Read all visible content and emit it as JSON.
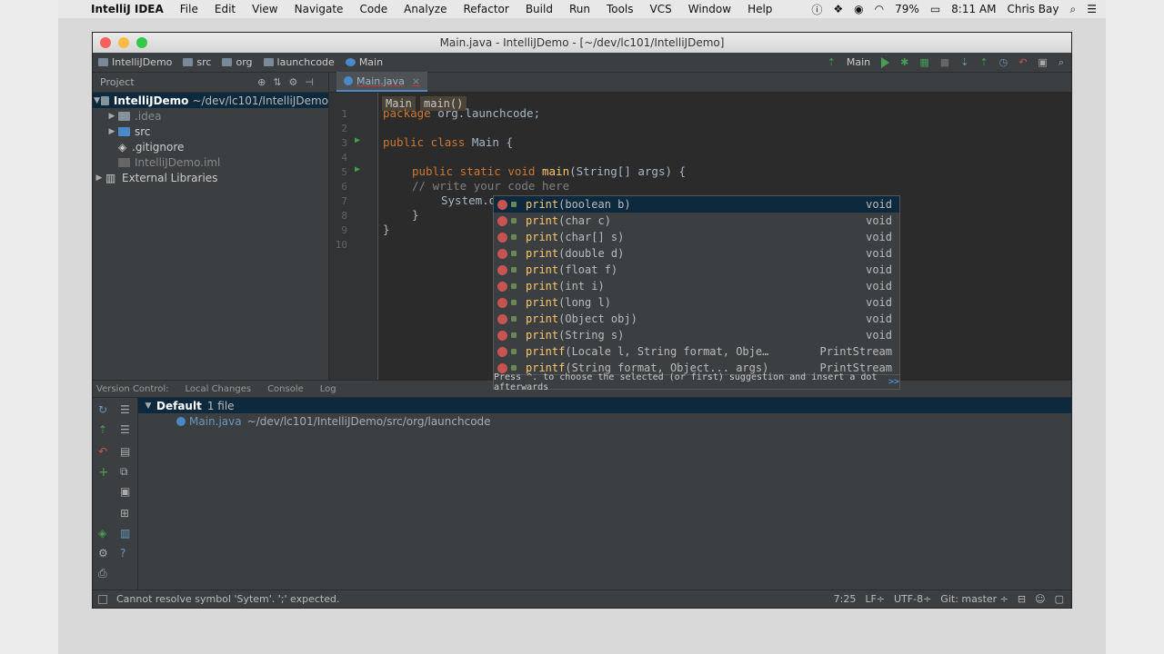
{
  "menubar": {
    "app": "IntelliJ IDEA",
    "items": [
      "File",
      "Edit",
      "View",
      "Navigate",
      "Code",
      "Analyze",
      "Refactor",
      "Build",
      "Run",
      "Tools",
      "VCS",
      "Window",
      "Help"
    ],
    "battery": "79%",
    "time": "8:11 AM",
    "user": "Chris Bay"
  },
  "window": {
    "title": "Main.java - IntelliJDemo - [~/dev/lc101/IntelliJDemo]"
  },
  "navbar": {
    "crumbs": [
      "IntelliJDemo",
      "src",
      "org",
      "launchcode",
      "Main"
    ],
    "run_config": "Main"
  },
  "project": {
    "header": "Project",
    "root": "IntelliJDemo",
    "root_path": "~/dev/lc101/IntelliJDemo",
    "items": [
      ".idea",
      "src",
      ".gitignore",
      "IntelliJDemo.iml"
    ],
    "external": "External Libraries"
  },
  "editor": {
    "tab": "Main.java",
    "breadcrumb": [
      "Main",
      "main()"
    ],
    "lines": [
      "1",
      "2",
      "3",
      "4",
      "5",
      "6",
      "7",
      "8",
      "9",
      "10"
    ],
    "code": {
      "l1_kw": "package",
      "l1_rest": " org.launchcode;",
      "l3_kw": "public class",
      "l3_rest": " Main {",
      "l5_kw": "public static void",
      "l5_fn": "main",
      "l5_rest": "(String[] args) {",
      "l6": "// write your code here",
      "l7": "System.out.print",
      "l8": "}",
      "l9": "}"
    }
  },
  "completion": {
    "items": [
      {
        "name": "print",
        "args": "(boolean b)",
        "type": "void"
      },
      {
        "name": "print",
        "args": "(char c)",
        "type": "void"
      },
      {
        "name": "print",
        "args": "(char[] s)",
        "type": "void"
      },
      {
        "name": "print",
        "args": "(double d)",
        "type": "void"
      },
      {
        "name": "print",
        "args": "(float f)",
        "type": "void"
      },
      {
        "name": "print",
        "args": "(int i)",
        "type": "void"
      },
      {
        "name": "print",
        "args": "(long l)",
        "type": "void"
      },
      {
        "name": "print",
        "args": "(Object obj)",
        "type": "void"
      },
      {
        "name": "print",
        "args": "(String s)",
        "type": "void"
      },
      {
        "name": "printf",
        "args": "(Locale l, String format, Obje…",
        "type": "PrintStream"
      },
      {
        "name": "printf",
        "args": "(String format, Object... args)",
        "type": "PrintStream"
      }
    ],
    "footer": "Press ^. to choose the selected (or first) suggestion and insert a dot afterwards",
    "footer_link": ">>"
  },
  "bottom_tabs": [
    "Version Control:",
    "Local Changes",
    "Console",
    "Log"
  ],
  "vcs": {
    "changelist": "Default",
    "count": "1 file",
    "file": "Main.java",
    "file_path": "~/dev/lc101/IntelliJDemo/src/org/launchcode"
  },
  "status": {
    "message": "Cannot resolve symbol 'Sytem'. ';' expected.",
    "position": "7:25",
    "line_sep": "LF÷",
    "encoding": "UTF-8÷",
    "git": "Git: master ÷"
  }
}
